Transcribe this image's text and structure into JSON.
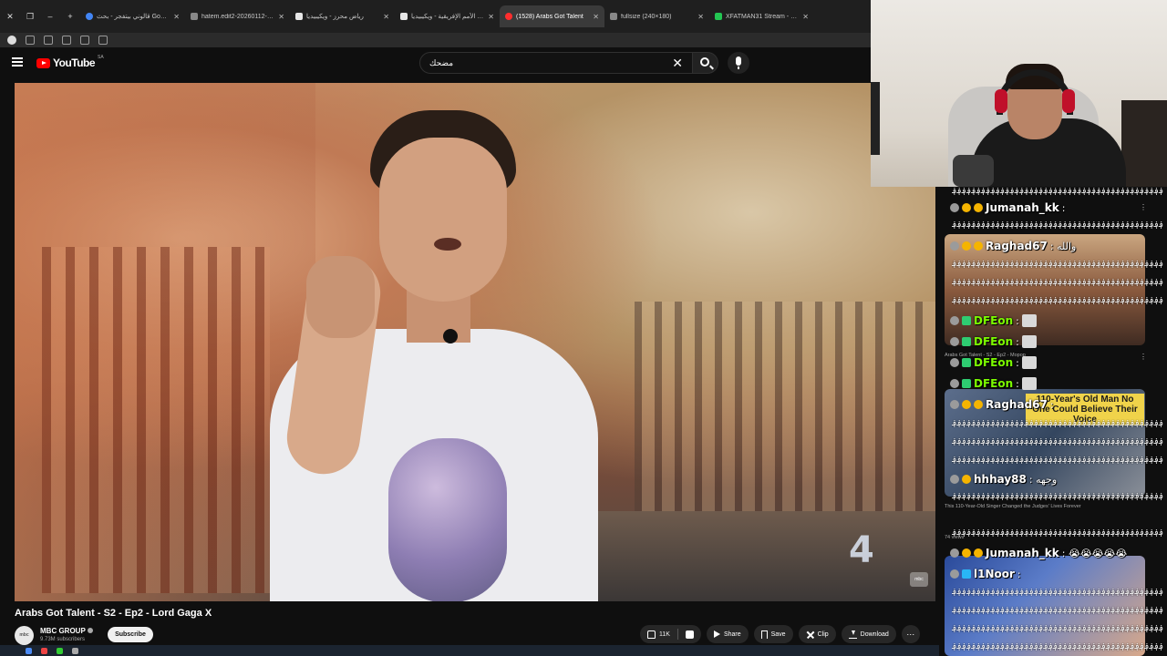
{
  "browser": {
    "tabs": [
      {
        "label": "قالوني بيتفجر - بحث Google",
        "favicon": "google-icon",
        "active": false
      },
      {
        "label": "hatem.edit2-20260112-0001",
        "favicon": "file-icon",
        "active": false
      },
      {
        "label": "رياض محرز - ويكيبيديا",
        "favicon": "wikipedia-icon",
        "active": false
      },
      {
        "label": "كأس الأمم الإفريقية - ويكيبيديا",
        "favicon": "wikipedia-icon",
        "active": false
      },
      {
        "label": "(1528) Arabs Got Talent",
        "favicon": "youtube-icon",
        "active": true
      },
      {
        "label": "fullsize (240×180)",
        "favicon": "file-icon",
        "active": false
      },
      {
        "label": "XFATMAN31 Stream - Watch",
        "favicon": "twitch-icon",
        "active": false
      }
    ]
  },
  "youtube": {
    "logo_text": "YouTube",
    "country_code": "SA",
    "search_value": "مضحك"
  },
  "video": {
    "title": "Arabs Got Talent - S2 - Ep2 - Lord Gaga X",
    "channel_name": "MBC GROUP",
    "channel_avatar_text": "mbc",
    "subscribers": "9.73M subscribers",
    "subscribe_label": "Subscribe",
    "likes": "11K",
    "share_label": "Share",
    "save_label": "Save",
    "clip_label": "Clip",
    "download_label": "Download",
    "watermark": "mbc"
  },
  "sidebar_overlay": {
    "overlay_text": "110-Year's Old Man No One Could Believe Their Voice",
    "meta_1": "Arabs Got Talent - S2 - Ep2 - Mopop",
    "meta_2": "This 110-Year-Old Singer Changed the Judges' Lives Forever",
    "meta_3": "74 views"
  },
  "chat": {
    "messages": [
      {
        "user": "Jumanah_kk",
        "color": "#ffffff",
        "text": ":"
      },
      {
        "user": "Raghad67",
        "color": "#ffffff",
        "text": ": والله"
      },
      {
        "user": "DFEon",
        "color": "#7cfc00",
        "text": ":"
      },
      {
        "user": "DFEon",
        "color": "#7cfc00",
        "text": ":"
      },
      {
        "user": "DFEon",
        "color": "#7cfc00",
        "text": ":"
      },
      {
        "user": "DFEon",
        "color": "#7cfc00",
        "text": ":"
      },
      {
        "user": "Raghad67",
        "color": "#ffffff",
        "text": ":"
      },
      {
        "user": "hhhay88",
        "color": "#ffffff",
        "text": ": وجهه"
      },
      {
        "user": "Jumanah_kk",
        "color": "#ffffff",
        "text": ": 😭😭😭😭😭"
      },
      {
        "user": "l1Noor",
        "color": "#ffffff",
        "text": ":"
      }
    ]
  }
}
